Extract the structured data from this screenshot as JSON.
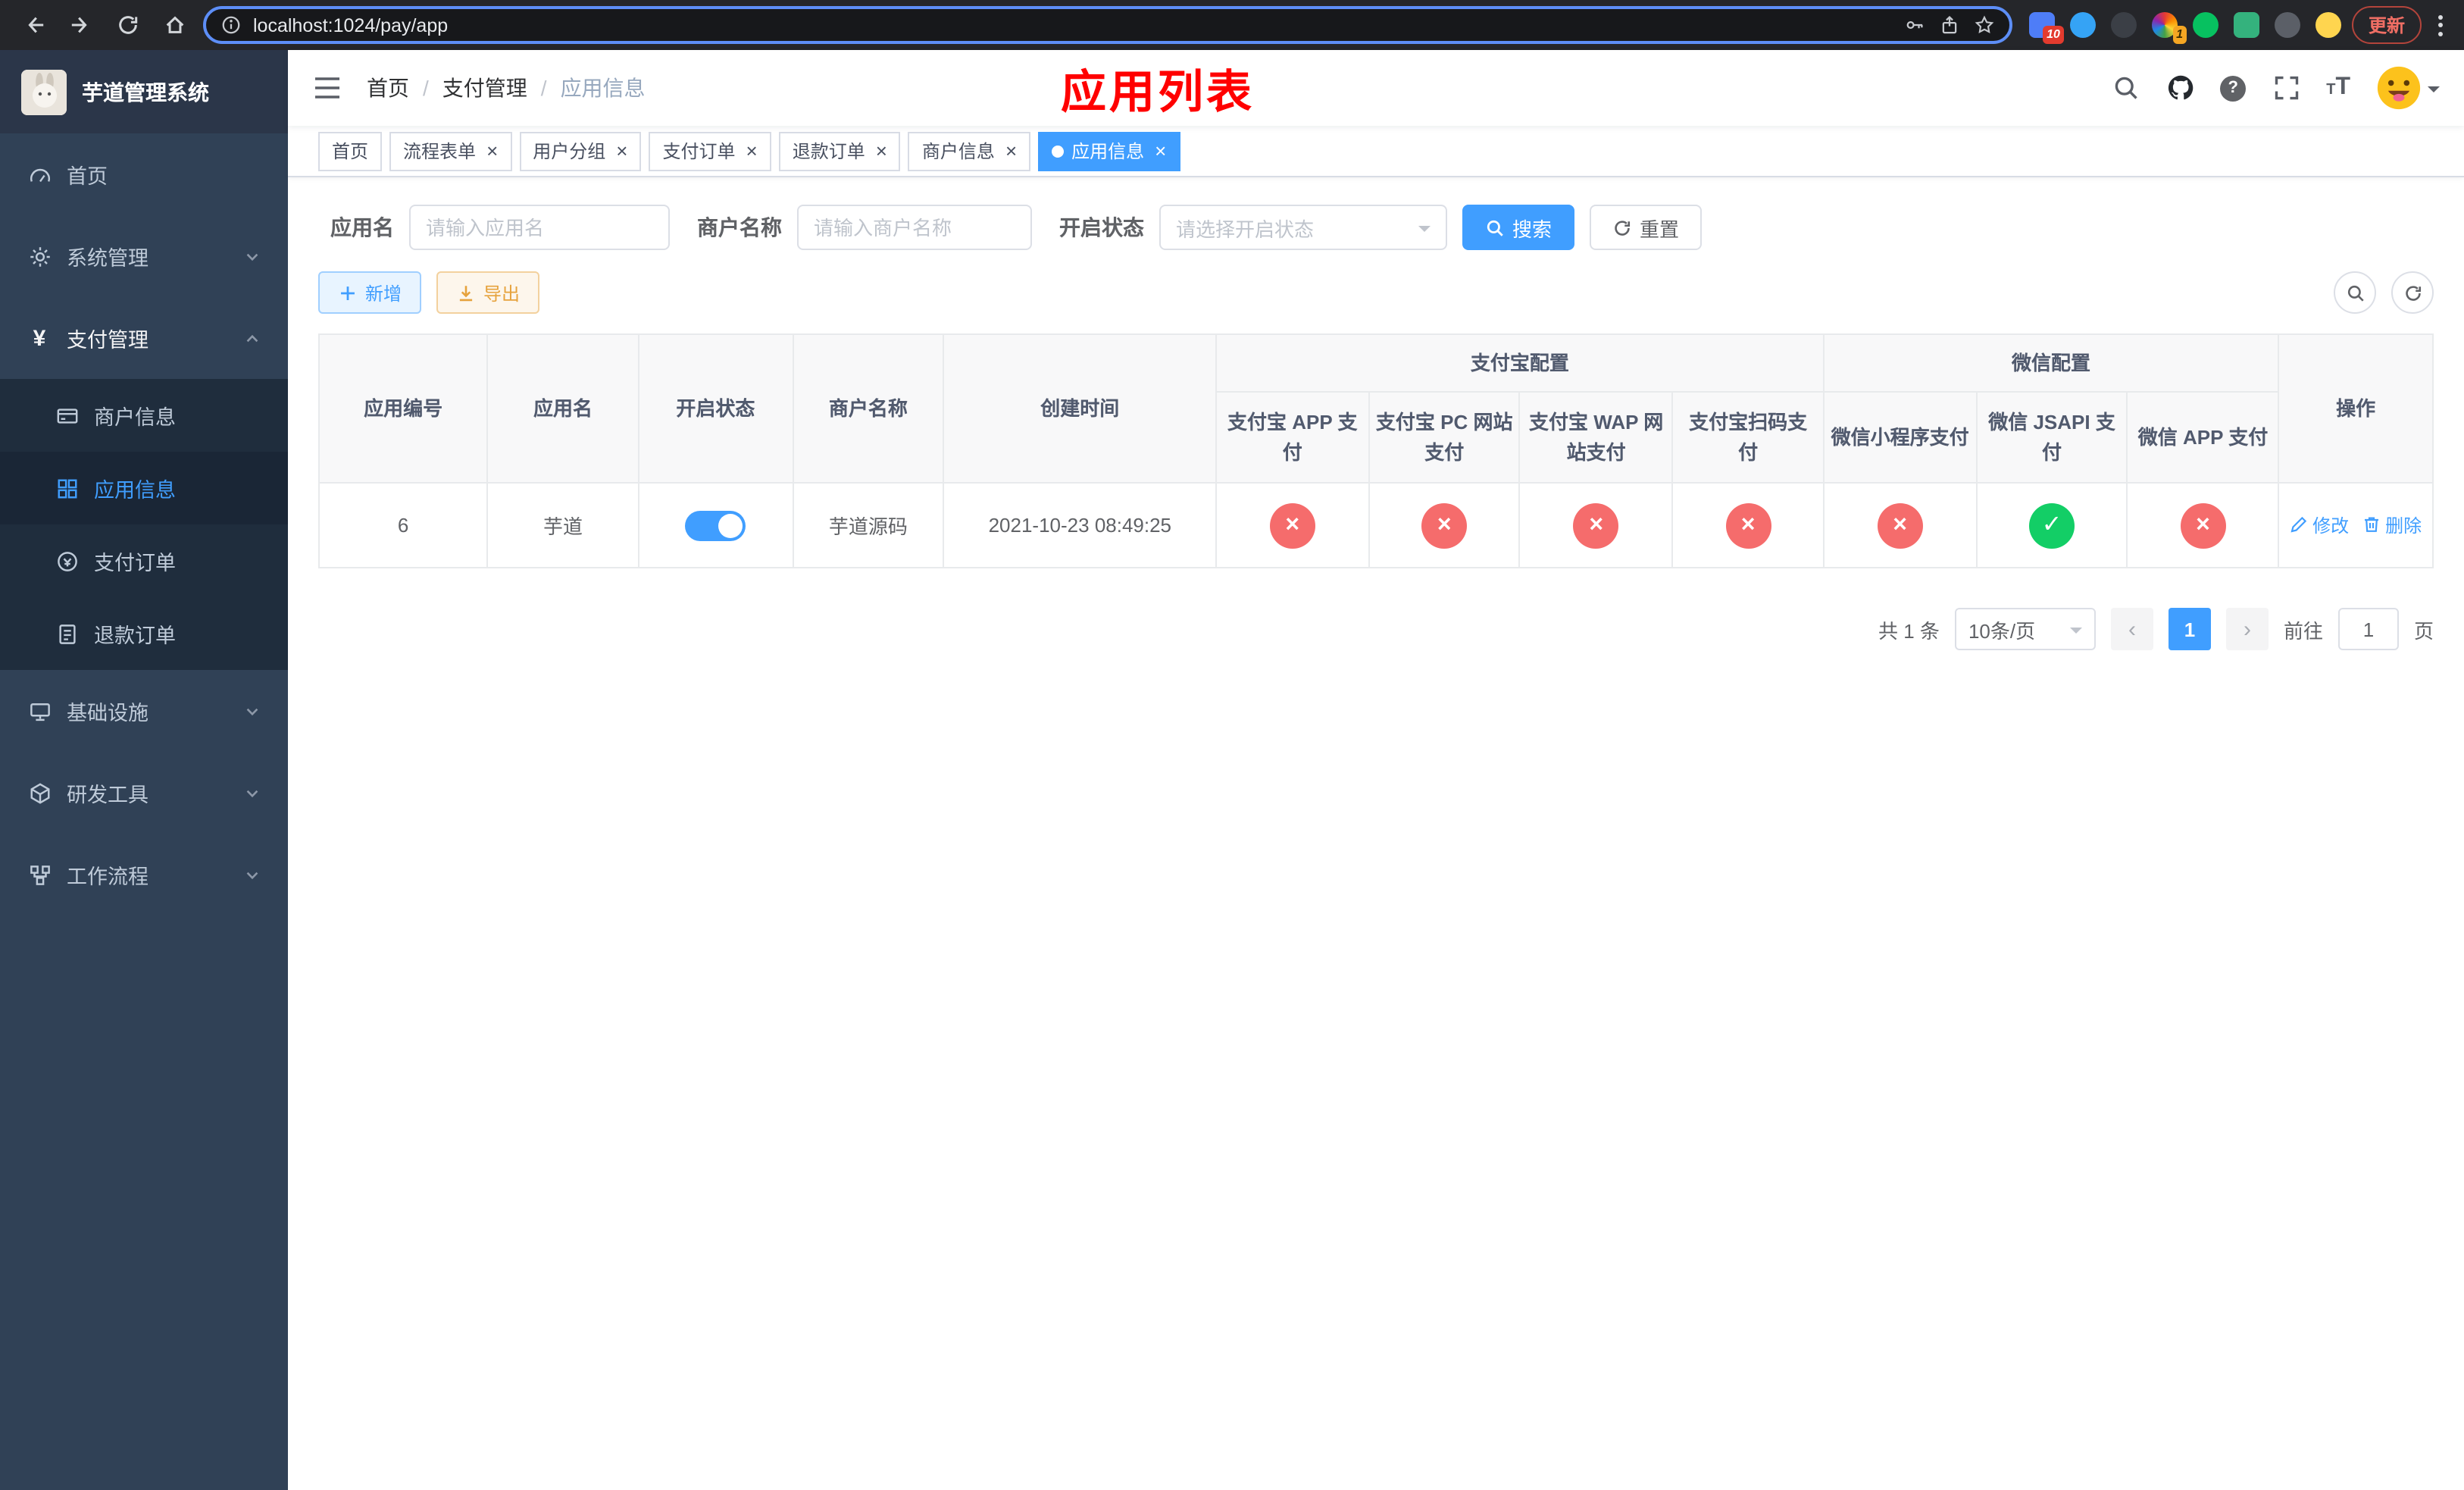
{
  "colors": {
    "primary": "#409eff",
    "danger": "#f56c6c",
    "success": "#13ce66",
    "page_title_red": "#ff0000",
    "sidebar_bg": "#304156",
    "sidebar_submenu_bg": "#1f2d3d"
  },
  "icons": {
    "close": "×",
    "check": "✓",
    "cross": "×",
    "prev": "‹",
    "next": "›",
    "question": "?"
  },
  "browser": {
    "url": "localhost:1024/pay/app",
    "update_button": "更新",
    "extension_badges": {
      "puzzle_blue": "10",
      "rainbow": "1"
    }
  },
  "sidebar": {
    "logo_title": "芋道管理系统",
    "menu": [
      {
        "label": "首页",
        "icon": "dashboard-icon"
      },
      {
        "label": "系统管理",
        "icon": "gear-icon",
        "expanded": false
      },
      {
        "label": "支付管理",
        "icon": "yen-icon",
        "expanded": true
      },
      {
        "label": "基础设施",
        "icon": "monitor-icon",
        "expanded": false
      },
      {
        "label": "研发工具",
        "icon": "toolbox-icon",
        "expanded": false
      },
      {
        "label": "工作流程",
        "icon": "workflow-icon",
        "expanded": false
      }
    ],
    "payment_submenu": [
      {
        "label": "商户信息",
        "icon": "bank-card-icon",
        "active": false
      },
      {
        "label": "应用信息",
        "icon": "grid-icon",
        "active": true
      },
      {
        "label": "支付订单",
        "icon": "order-icon",
        "active": false
      },
      {
        "label": "退款订单",
        "icon": "refund-icon",
        "active": false
      }
    ]
  },
  "header": {
    "breadcrumb": [
      "首页",
      "支付管理",
      "应用信息"
    ],
    "page_title": "应用列表"
  },
  "tabs": [
    {
      "label": "首页",
      "closable": false,
      "active": false
    },
    {
      "label": "流程表单",
      "closable": true,
      "active": false
    },
    {
      "label": "用户分组",
      "closable": true,
      "active": false
    },
    {
      "label": "支付订单",
      "closable": true,
      "active": false
    },
    {
      "label": "退款订单",
      "closable": true,
      "active": false
    },
    {
      "label": "商户信息",
      "closable": true,
      "active": false
    },
    {
      "label": "应用信息",
      "closable": true,
      "active": true
    }
  ],
  "filters": {
    "app_name": {
      "label": "应用名",
      "placeholder": "请输入应用名",
      "value": ""
    },
    "merchant_name": {
      "label": "商户名称",
      "placeholder": "请输入商户名称",
      "value": ""
    },
    "status": {
      "label": "开启状态",
      "placeholder": "请选择开启状态",
      "value": ""
    },
    "search_button": "搜索",
    "reset_button": "重置"
  },
  "toolbar": {
    "add_button": "新增",
    "export_button": "导出"
  },
  "table": {
    "headers": {
      "app_id": "应用编号",
      "app_name": "应用名",
      "status": "开启状态",
      "merchant_name": "商户名称",
      "create_time": "创建时间",
      "alipay_group": "支付宝配置",
      "alipay_app": "支付宝 APP 支付",
      "alipay_pc": "支付宝 PC 网站支付",
      "alipay_wap": "支付宝 WAP 网站支付",
      "alipay_qr": "支付宝扫码支付",
      "wechat_group": "微信配置",
      "wechat_mini": "微信小程序支付",
      "wechat_jsapi": "微信 JSAPI 支付",
      "wechat_app": "微信 APP 支付",
      "actions": "操作"
    },
    "rows": [
      {
        "app_id": "6",
        "app_name": "芋道",
        "enabled": true,
        "merchant_name": "芋道源码",
        "create_time": "2021-10-23 08:49:25",
        "alipay_app": "fail",
        "alipay_pc": "fail",
        "alipay_wap": "fail",
        "alipay_qr": "fail",
        "wechat_mini": "fail",
        "wechat_jsapi": "success",
        "wechat_app": "fail",
        "edit_label": "修改",
        "delete_label": "删除"
      }
    ]
  },
  "pagination": {
    "total_text": "共 1 条",
    "page_size": "10条/页",
    "current_page": "1",
    "goto_prefix": "前往",
    "goto_value": "1",
    "goto_suffix": "页"
  }
}
